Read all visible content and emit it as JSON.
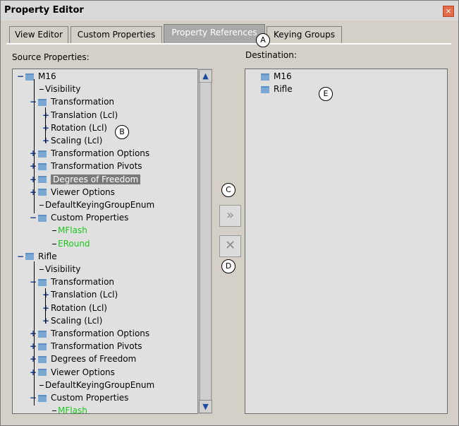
{
  "window": {
    "title": "Property Editor",
    "close_glyph": "×"
  },
  "tabs": [
    {
      "label": "View Editor"
    },
    {
      "label": "Custom Properties"
    },
    {
      "label": "Property References",
      "active": true
    },
    {
      "label": "Keying Groups"
    }
  ],
  "source": {
    "label": "Source Properties:",
    "tree": [
      {
        "text": "M16",
        "expander": "−",
        "folder": true
      },
      {
        "text": "Visibility"
      },
      {
        "text": "Transformation",
        "expander": "−",
        "folder": true
      },
      {
        "text": "Translation (Lcl)",
        "expander": "+"
      },
      {
        "text": "Rotation (Lcl)",
        "expander": "+"
      },
      {
        "text": "Scaling (Lcl)",
        "expander": "+"
      },
      {
        "text": "Transformation Options",
        "expander": "+",
        "folder": true
      },
      {
        "text": "Transformation Pivots",
        "expander": "+",
        "folder": true
      },
      {
        "text": "Degrees of Freedom",
        "expander": "+",
        "folder": true,
        "selected": true
      },
      {
        "text": "Viewer Options",
        "expander": "+",
        "folder": true
      },
      {
        "text": "DefaultKeyingGroupEnum"
      },
      {
        "text": "Custom Properties",
        "expander": "−",
        "folder": true
      },
      {
        "text": "MFlash",
        "green": true
      },
      {
        "text": "ERound",
        "green": true
      },
      {
        "text": "Rifle",
        "expander": "−",
        "folder": true
      },
      {
        "text": "Visibility"
      },
      {
        "text": "Transformation",
        "expander": "−",
        "folder": true
      },
      {
        "text": "Translation (Lcl)",
        "expander": "+"
      },
      {
        "text": "Rotation (Lcl)",
        "expander": "+"
      },
      {
        "text": "Scaling (Lcl)",
        "expander": "+"
      },
      {
        "text": "Transformation Options",
        "expander": "+",
        "folder": true
      },
      {
        "text": "Transformation Pivots",
        "expander": "+",
        "folder": true
      },
      {
        "text": "Degrees of Freedom",
        "expander": "+",
        "folder": true
      },
      {
        "text": "Viewer Options",
        "expander": "+",
        "folder": true
      },
      {
        "text": "DefaultKeyingGroupEnum"
      },
      {
        "text": "Custom Properties",
        "expander": "−",
        "folder": true
      },
      {
        "text": "MFlash",
        "green": true
      }
    ]
  },
  "destination": {
    "label": "Destination:",
    "items": [
      {
        "text": "M16"
      },
      {
        "text": "Rifle"
      }
    ]
  },
  "buttons": {
    "add_glyph": "»",
    "remove_glyph": "✕"
  },
  "scroll": {
    "up_glyph": "▲",
    "down_glyph": "▼"
  },
  "markers": {
    "a": "A",
    "b": "B",
    "c": "C",
    "d": "D",
    "e": "E"
  }
}
